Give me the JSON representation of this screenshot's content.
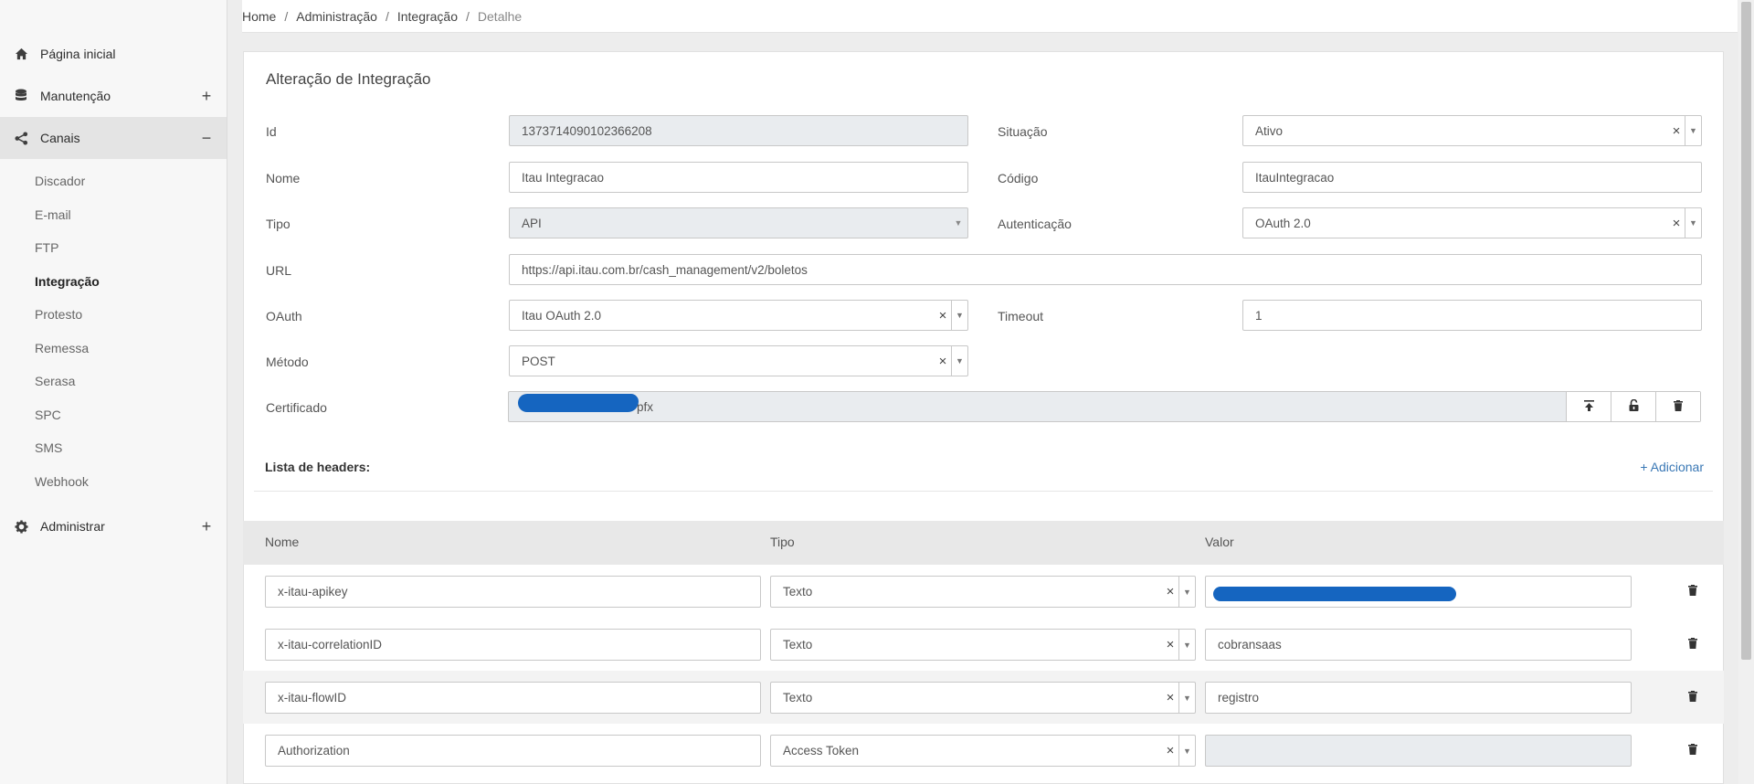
{
  "sidebar": {
    "home": "Página inicial",
    "manutencao": "Manutenção",
    "canais": "Canais",
    "administrar": "Administrar",
    "plus": "+",
    "minus": "−",
    "sub_items": [
      "Discador",
      "E-mail",
      "FTP",
      "Integração",
      "Protesto",
      "Remessa",
      "Serasa",
      "SPC",
      "SMS",
      "Webhook"
    ],
    "active_sub": "Integração"
  },
  "breadcrumb": [
    "Home",
    "Administração",
    "Integração",
    "Detalhe"
  ],
  "breadcrumb_sep": "/",
  "form": {
    "title": "Alteração de Integração",
    "id_label": "Id",
    "id_value": "1373714090102366208",
    "situacao_label": "Situação",
    "situacao_value": "Ativo",
    "nome_label": "Nome",
    "nome_value": "Itau Integracao",
    "codigo_label": "Código",
    "codigo_value": "ItauIntegracao",
    "tipo_label": "Tipo",
    "tipo_value": "API",
    "autenticacao_label": "Autenticação",
    "autenticacao_value": "OAuth 2.0",
    "url_label": "URL",
    "url_value": "https://api.itau.com.br/cash_management/v2/boletos",
    "oauth_label": "OAuth",
    "oauth_value": "Itau OAuth 2.0",
    "timeout_label": "Timeout",
    "timeout_value": "1",
    "metodo_label": "Método",
    "metodo_value": "POST",
    "certificado_label": "Certificado",
    "certificado_value": "pfx",
    "clear_symbol": "×",
    "dropdown_symbol": "▼"
  },
  "headers": {
    "title": "Lista de headers:",
    "add_label": "+ Adicionar",
    "col_nome": "Nome",
    "col_tipo": "Tipo",
    "col_valor": "Valor",
    "rows": [
      {
        "nome": "x-itau-apikey",
        "tipo": "Texto",
        "valor": ""
      },
      {
        "nome": "x-itau-correlationID",
        "tipo": "Texto",
        "valor": "cobransaas"
      },
      {
        "nome": "x-itau-flowID",
        "tipo": "Texto",
        "valor": "registro"
      },
      {
        "nome": "Authorization",
        "tipo": "Access Token",
        "valor": ""
      }
    ]
  },
  "icons": {
    "home": "home-icon",
    "manutencao": "database-icon",
    "canais": "share-icon",
    "administrar": "gear-icon",
    "upload": "upload-icon",
    "unlock": "unlock-icon",
    "trash": "trash-icon"
  }
}
